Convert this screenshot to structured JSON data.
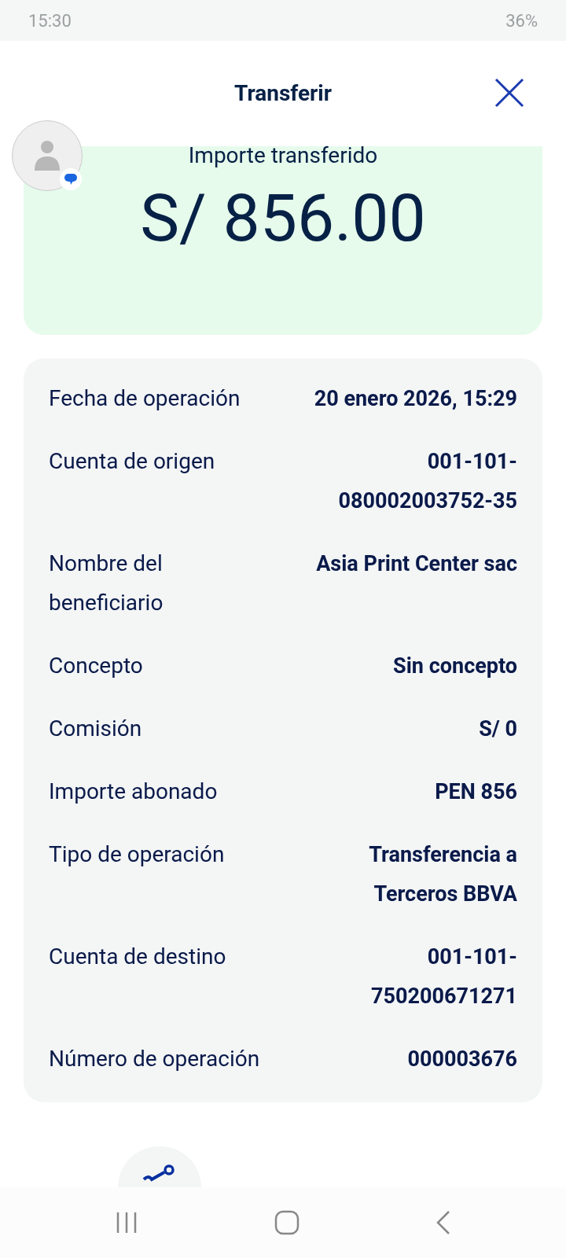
{
  "status_bar": {
    "time": "15:30",
    "battery": "36%"
  },
  "header": {
    "title": "Transferir"
  },
  "amount_card": {
    "label": "Importe transferido",
    "amount": "S/ 856.00"
  },
  "details": [
    {
      "label": "Fecha de operación",
      "value": "20 enero 2026, 15:29"
    },
    {
      "label": "Cuenta de origen",
      "value": "001-101-080002003752-35"
    },
    {
      "label": "Nombre del beneficiario",
      "value": "Asia Print Center sac"
    },
    {
      "label": "Concepto",
      "value": "Sin concepto"
    },
    {
      "label": "Comisión",
      "value": "S/ 0"
    },
    {
      "label": "Importe abonado",
      "value": "PEN 856"
    },
    {
      "label": "Tipo de operación",
      "value": "Transferencia a Terceros BBVA"
    },
    {
      "label": "Cuenta de destino",
      "value": "001-101-750200671271"
    },
    {
      "label": "Número de operación",
      "value": "000003676"
    }
  ]
}
